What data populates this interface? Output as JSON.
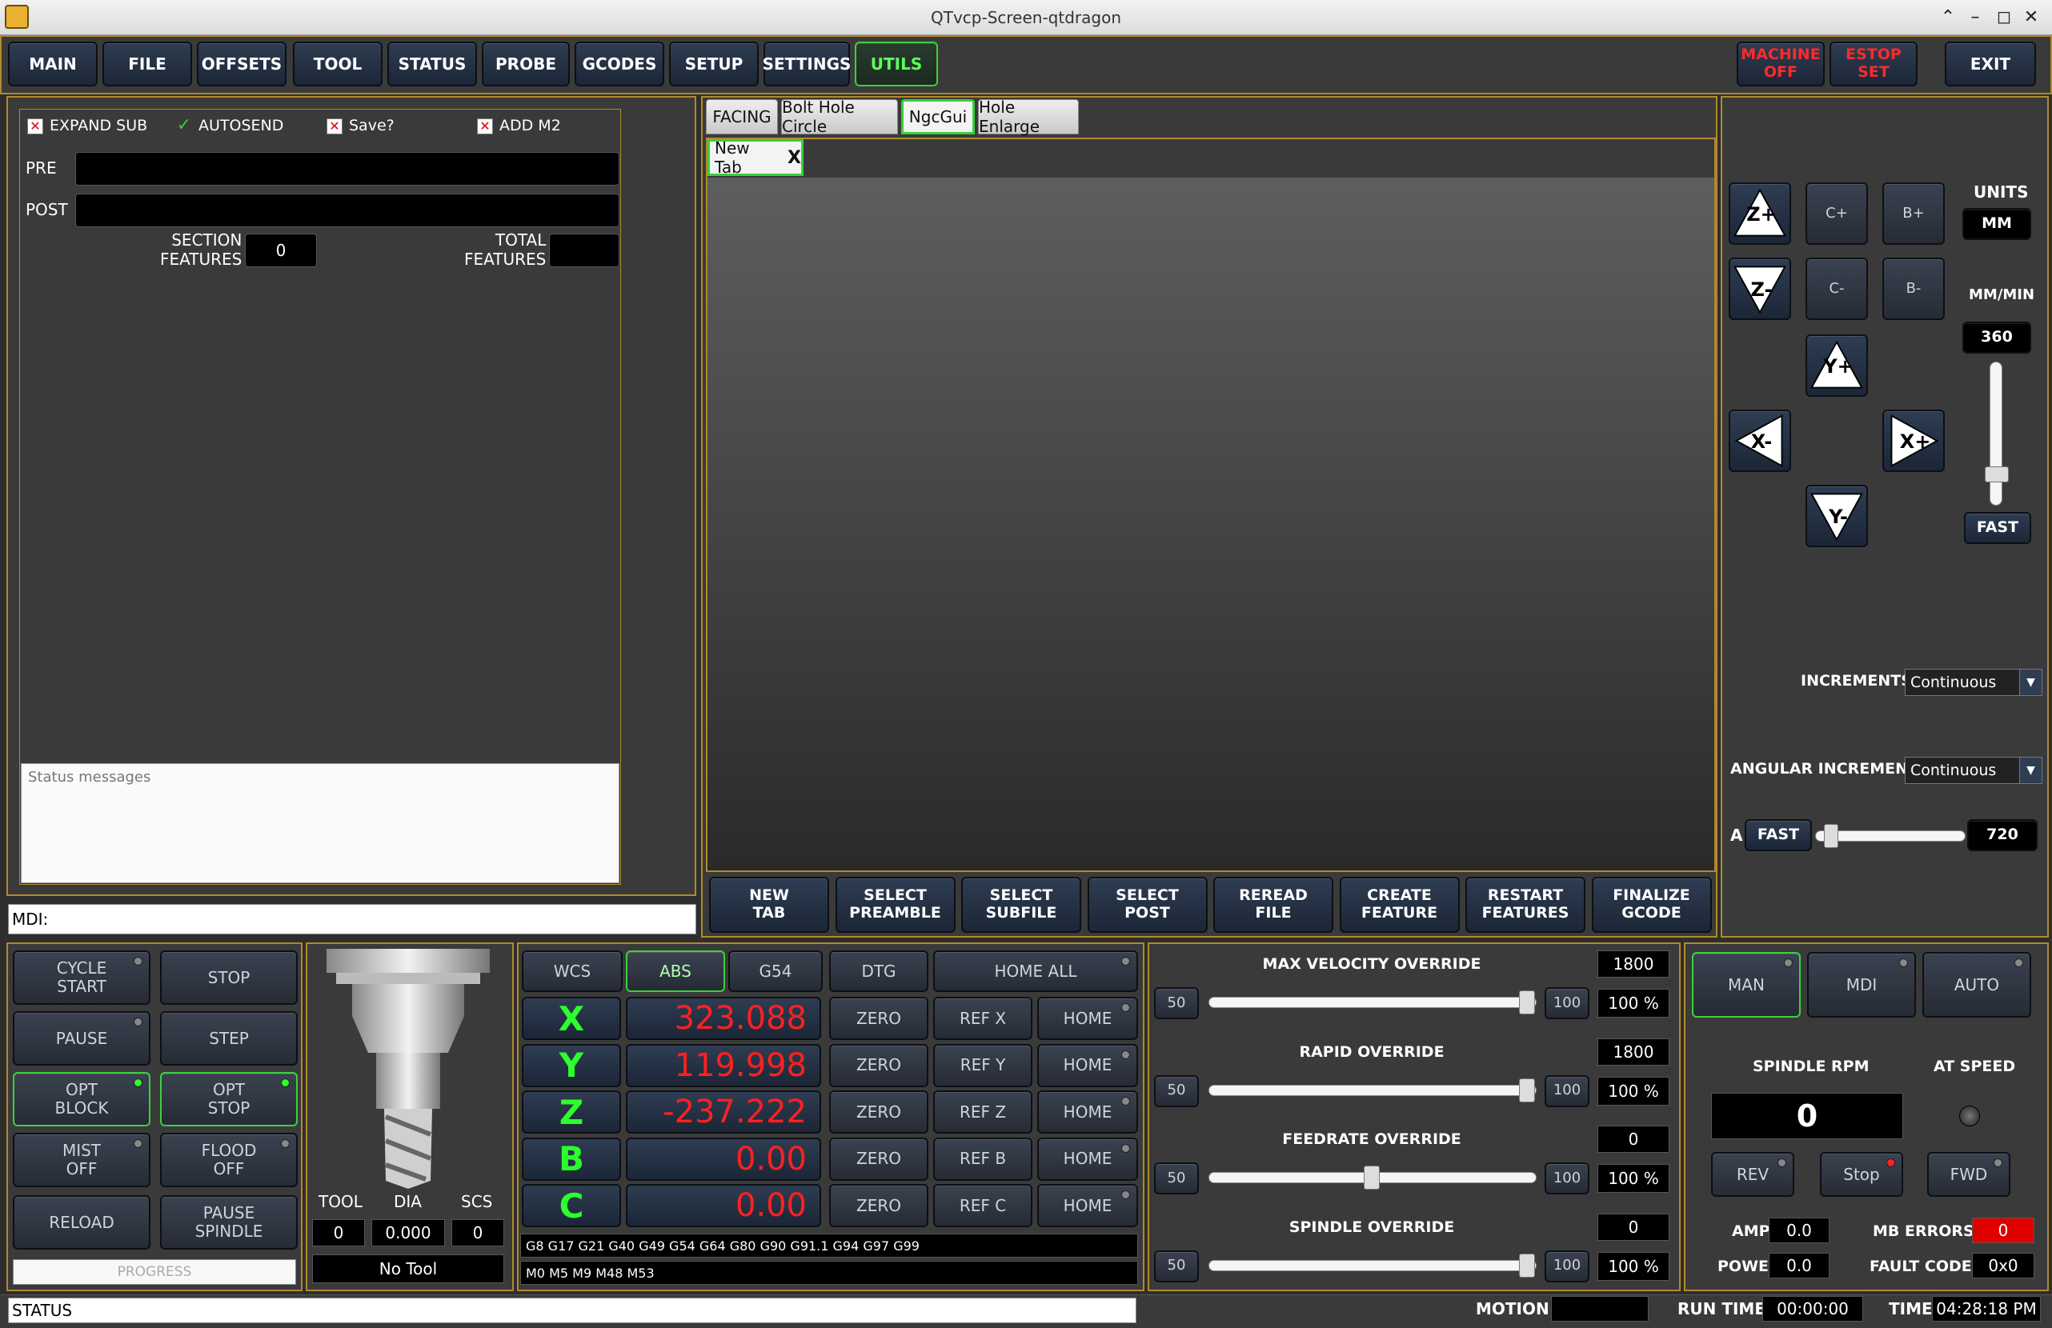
{
  "window": {
    "title": "QTvcp-Screen-qtdragon"
  },
  "top_nav": [
    "MAIN",
    "FILE",
    "OFFSETS",
    "TOOL",
    "STATUS",
    "PROBE",
    "GCODES",
    "SETUP",
    "SETTINGS",
    "UTILS"
  ],
  "top_right": {
    "machine": "MACHINE\nOFF",
    "estop": "ESTOP\nSET",
    "exit": "EXIT"
  },
  "ngc_left": {
    "checks": [
      {
        "label": "EXPAND SUB",
        "state": "x"
      },
      {
        "label": "AUTOSEND",
        "state": "check"
      },
      {
        "label": "Save?",
        "state": "x"
      },
      {
        "label": "ADD M2",
        "state": "x"
      }
    ],
    "pre_label": "PRE",
    "post_label": "POST",
    "section_label": "SECTION\nFEATURES",
    "section_value": "0",
    "total_label": "TOTAL\nFEATURES",
    "total_value": "",
    "status_placeholder": "Status messages",
    "mdi_label": "MDI:"
  },
  "tabs": [
    "FACING",
    "Bolt Hole Circle",
    "NgcGui",
    "Hole Enlarge"
  ],
  "subtab": {
    "label": "New Tab",
    "close": "X"
  },
  "ngc_buttons": [
    "NEW\nTAB",
    "SELECT\nPREAMBLE",
    "SELECT\nSUBFILE",
    "SELECT\nPOST",
    "REREAD\nFILE",
    "CREATE\nFEATURE",
    "RESTART\nFEATURES",
    "FINALIZE\nGCODE"
  ],
  "jog": {
    "z_plus": "Z+",
    "z_minus": "Z-",
    "c_plus": "C+",
    "c_minus": "C-",
    "b_plus": "B+",
    "b_minus": "B-",
    "y_plus": "Y+",
    "y_minus": "Y-",
    "x_minus": "X-",
    "x_plus": "X+",
    "units_label": "UNITS",
    "units": "MM",
    "rate_label": "MM/MIN",
    "rate": "360",
    "fast": "FAST",
    "increments_label": "INCREMENTS",
    "increments": "Continuous",
    "angular_label": "ANGULAR INCREMENT",
    "angular": "Continuous",
    "a_label": "A",
    "a_fast": "FAST",
    "a_value": "720",
    "rate_slider_fraction": 0.18,
    "a_slider_fraction": 0.05
  },
  "run_controls": {
    "cycle_start": "CYCLE\nSTART",
    "stop": "STOP",
    "pause": "PAUSE",
    "step": "STEP",
    "opt_block": "OPT\nBLOCK",
    "opt_stop": "OPT\nSTOP",
    "mist": "MIST\nOFF",
    "flood": "FLOOD\nOFF",
    "reload": "RELOAD",
    "pause_spindle": "PAUSE\nSPINDLE",
    "progress": "PROGRESS"
  },
  "tool": {
    "tool_label": "TOOL",
    "dia_label": "DIA",
    "scs_label": "SCS",
    "tool": "0",
    "dia": "0.000",
    "scs": "0",
    "name": "No Tool"
  },
  "dro": {
    "header": [
      "WCS",
      "ABS",
      "G54",
      "DTG",
      "HOME ALL"
    ],
    "axes": [
      {
        "name": "X",
        "value": "323.088",
        "ref": "REF X"
      },
      {
        "name": "Y",
        "value": "119.998",
        "ref": "REF Y"
      },
      {
        "name": "Z",
        "value": "-237.222",
        "ref": "REF Z"
      },
      {
        "name": "B",
        "value": "0.00",
        "ref": "REF B"
      },
      {
        "name": "C",
        "value": "0.00",
        "ref": "REF C"
      }
    ],
    "zero": "ZERO",
    "home": "HOME",
    "gcodes": "G8 G17 G21 G40 G49 G54 G64 G80 G90 G91.1 G94 G97 G99",
    "mcodes": "M0 M5 M9 M48 M53"
  },
  "overrides": [
    {
      "title": "MAX VELOCITY OVERRIDE",
      "value": "1800",
      "low": "50",
      "high": "100",
      "pct": "100 %",
      "fraction": 1.0
    },
    {
      "title": "RAPID OVERRIDE",
      "value": "1800",
      "low": "50",
      "high": "100",
      "pct": "100 %",
      "fraction": 1.0
    },
    {
      "title": "FEEDRATE OVERRIDE",
      "value": "0",
      "low": "50",
      "high": "100",
      "pct": "100 %",
      "fraction": 0.5
    },
    {
      "title": "SPINDLE OVERRIDE",
      "value": "0",
      "low": "50",
      "high": "100",
      "pct": "100 %",
      "fraction": 1.0
    }
  ],
  "spindle": {
    "modes": [
      "MAN",
      "MDI",
      "AUTO"
    ],
    "rpm_label": "SPINDLE RPM",
    "rpm": "0",
    "at_speed_label": "AT SPEED",
    "rev": "REV",
    "stop": "Stop",
    "fwd": "FWD",
    "amps_label": "AMPS",
    "amps": "0.0",
    "power_label": "POWER",
    "power": "0.0",
    "mb_errors_label": "MB ERRORS",
    "mb_errors": "0",
    "fault_label": "FAULT CODE",
    "fault": "0x0"
  },
  "status_bar": {
    "status": "STATUS",
    "motion_label": "MOTION",
    "motion": "",
    "run_time_label": "RUN TIME",
    "run_time": "00:00:00",
    "time_label": "TIME",
    "time": "04:28:18 PM"
  }
}
